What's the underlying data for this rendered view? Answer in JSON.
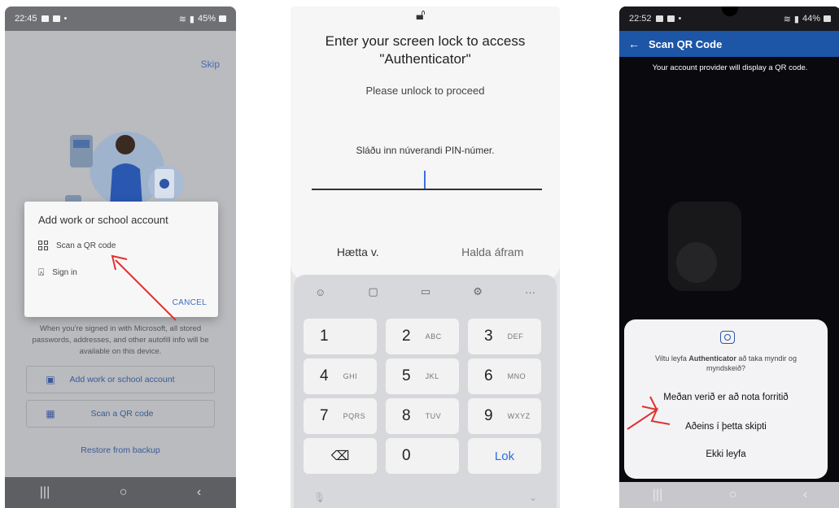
{
  "phone1": {
    "status": {
      "time": "22:45",
      "battery": "45%"
    },
    "skip": "Skip",
    "dialog": {
      "title": "Add work or school account",
      "scan_option": "Scan a QR code",
      "signin_option": "Sign in",
      "cancel": "CANCEL"
    },
    "info_text": "When you're signed in with Microsoft, all stored passwords, addresses, and other autofill info will be available on this device.",
    "add_account_button": "Add work or school account",
    "scan_qr_button": "Scan a QR code",
    "restore_link": "Restore from backup"
  },
  "phone2": {
    "title": "Enter your screen lock to access \"Authenticator\"",
    "subtitle": "Please unlock to proceed",
    "pin_label": "Sláðu inn núverandi PIN-númer.",
    "cancel": "Hætta v.",
    "continue": "Halda áfram",
    "keys": [
      {
        "num": "1",
        "letters": ""
      },
      {
        "num": "2",
        "letters": "ABC"
      },
      {
        "num": "3",
        "letters": "DEF"
      },
      {
        "num": "4",
        "letters": "GHI"
      },
      {
        "num": "5",
        "letters": "JKL"
      },
      {
        "num": "6",
        "letters": "MNO"
      },
      {
        "num": "7",
        "letters": "PQRS"
      },
      {
        "num": "8",
        "letters": "TUV"
      },
      {
        "num": "9",
        "letters": "WXYZ"
      },
      {
        "num": "0",
        "letters": ""
      }
    ],
    "ok_key": "Lok"
  },
  "phone3": {
    "status": {
      "time": "22:52",
      "battery": "44%"
    },
    "appbar_title": "Scan QR Code",
    "description": "Your account provider will display a QR code.",
    "permission": {
      "question_pre": "Viltu leyfa ",
      "app_name": "Authenticator",
      "question_post": " að taka myndir og myndskeið?",
      "option_while_using": "Meðan verið er að nota forritið",
      "option_only_this_time": "Aðeins í þetta skipti",
      "option_deny": "Ekki leyfa"
    }
  },
  "colors": {
    "accent_blue": "#1d55a7",
    "arrow_red": "#e0312f",
    "link_blue": "#3b5998"
  }
}
